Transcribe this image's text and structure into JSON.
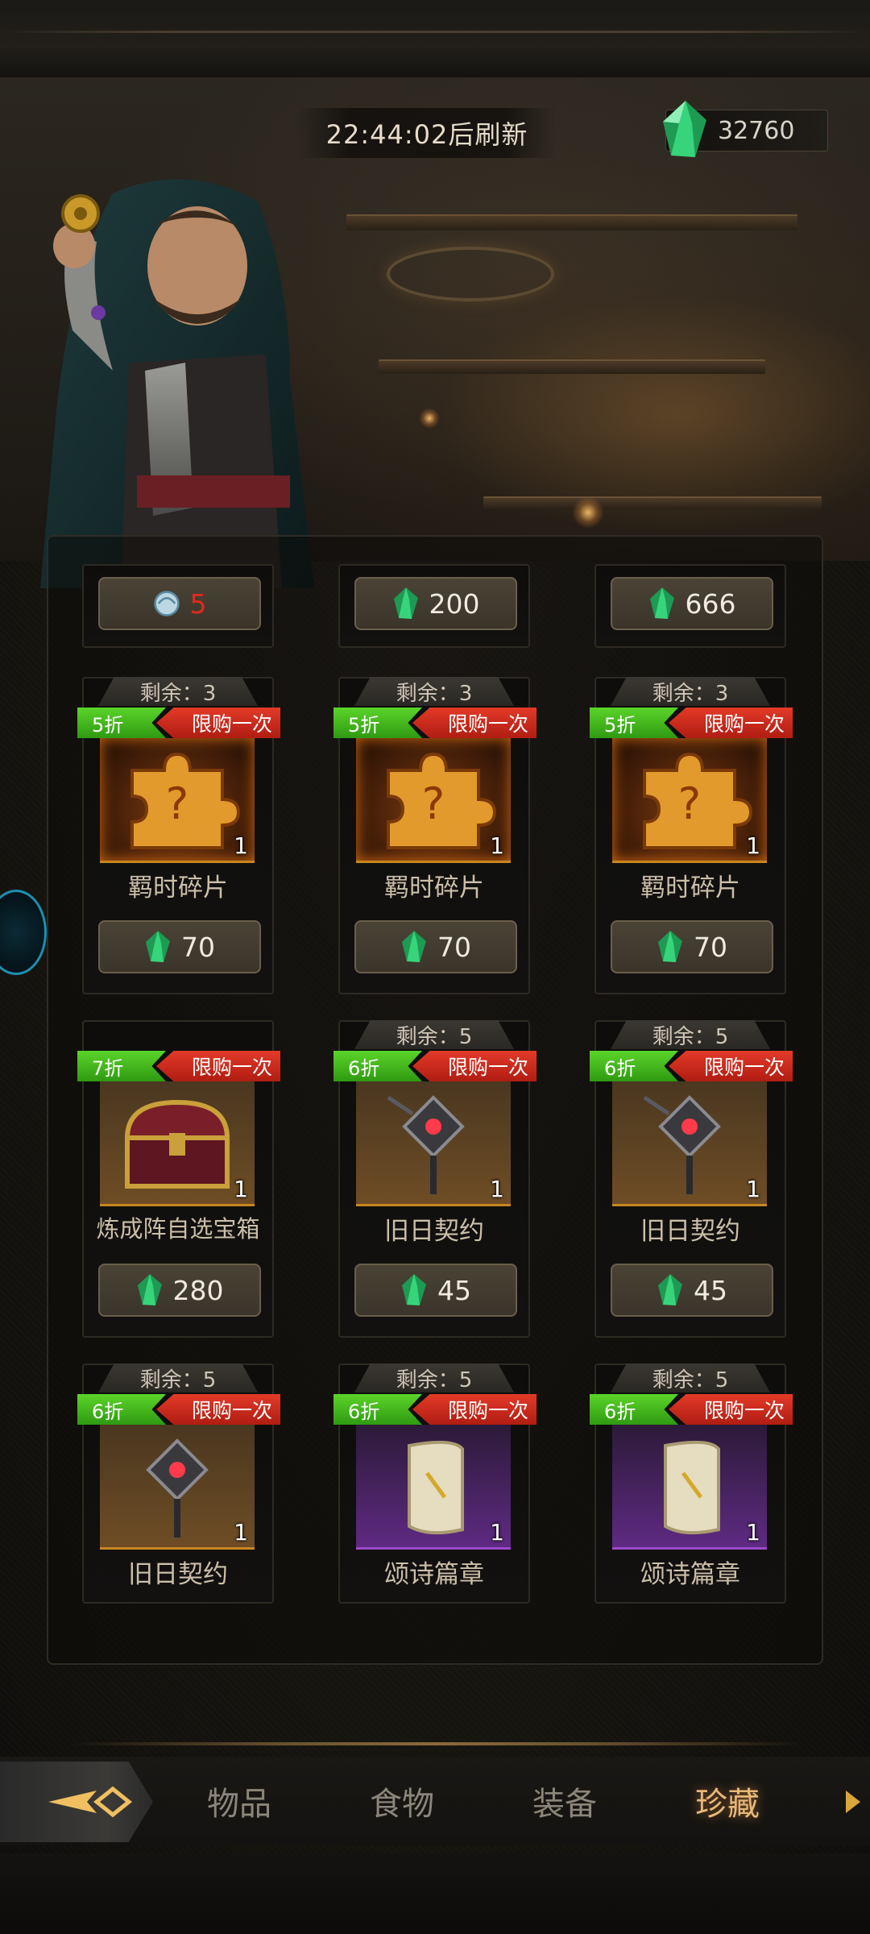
{
  "header": {
    "refresh_timer": "22:44:02后刷新",
    "gem_balance": "32760"
  },
  "partial_row": [
    {
      "price": "5",
      "price_color": "#e02a1e",
      "currency_icon": "shell-icon"
    },
    {
      "price": "200",
      "currency_icon": "green-gem-icon"
    },
    {
      "price": "666",
      "currency_icon": "green-gem-icon"
    }
  ],
  "items": [
    {
      "remain": "剩余：3",
      "discount": "5折",
      "limit": "限购一次",
      "name": "羁时碎片",
      "count": "1",
      "price": "70",
      "icon": "puzzle-piece-icon"
    },
    {
      "remain": "剩余：3",
      "discount": "5折",
      "limit": "限购一次",
      "name": "羁时碎片",
      "count": "1",
      "price": "70",
      "icon": "puzzle-piece-icon"
    },
    {
      "remain": "剩余：3",
      "discount": "5折",
      "limit": "限购一次",
      "name": "羁时碎片",
      "count": "1",
      "price": "70",
      "icon": "puzzle-piece-icon"
    },
    {
      "remain": "",
      "discount": "7折",
      "limit": "限购一次",
      "name": "炼成阵自选宝箱",
      "count": "1",
      "price": "280",
      "icon": "treasure-chest-icon"
    },
    {
      "remain": "剩余：5",
      "discount": "6折",
      "limit": "限购一次",
      "name": "旧日契约",
      "count": "1",
      "price": "45",
      "icon": "contract-sigil-icon"
    },
    {
      "remain": "剩余：5",
      "discount": "6折",
      "limit": "限购一次",
      "name": "旧日契约",
      "count": "1",
      "price": "45",
      "icon": "contract-sigil-icon"
    },
    {
      "remain": "剩余：5",
      "discount": "6折",
      "limit": "限购一次",
      "name": "旧日契约",
      "count": "1",
      "icon": "contract-sigil-icon"
    },
    {
      "remain": "剩余：5",
      "discount": "6折",
      "limit": "限购一次",
      "name": "颂诗篇章",
      "count": "1",
      "icon": "scroll-icon"
    },
    {
      "remain": "剩余：5",
      "discount": "6折",
      "limit": "限购一次",
      "name": "颂诗篇章",
      "count": "1",
      "icon": "scroll-icon"
    }
  ],
  "tabs": [
    {
      "label": "物品",
      "active": false
    },
    {
      "label": "食物",
      "active": false
    },
    {
      "label": "装备",
      "active": false
    },
    {
      "label": "珍藏",
      "active": true
    }
  ],
  "colors": {
    "discount_green": "#3fb81b",
    "limit_red": "#c72418",
    "active_tab": "#e8b879",
    "gem_green": "#22c46a"
  }
}
